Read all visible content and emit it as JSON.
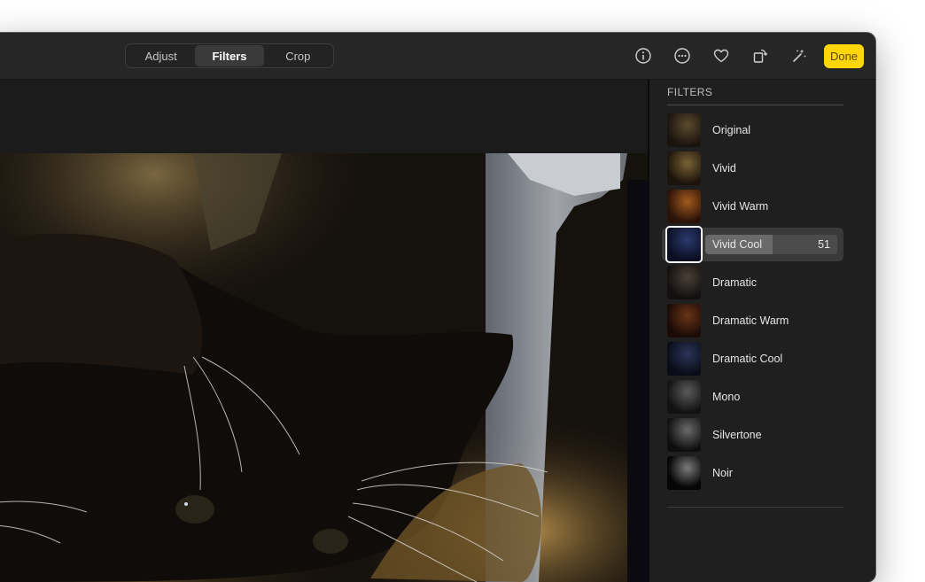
{
  "toolbar": {
    "tabs": [
      "Adjust",
      "Filters",
      "Crop"
    ],
    "active_tab": "Filters",
    "icons": [
      "info-icon",
      "more-icon",
      "heart-icon",
      "rotate-icon",
      "magic-wand-icon"
    ],
    "done_label": "Done",
    "done_color": "#ffd60a"
  },
  "sidebar": {
    "title": "FILTERS",
    "filters": [
      {
        "label": "Original"
      },
      {
        "label": "Vivid"
      },
      {
        "label": "Vivid Warm"
      },
      {
        "label": "Vivid Cool",
        "selected": true,
        "intensity": 51
      },
      {
        "label": "Dramatic"
      },
      {
        "label": "Dramatic Warm"
      },
      {
        "label": "Dramatic Cool"
      },
      {
        "label": "Mono"
      },
      {
        "label": "Silvertone"
      },
      {
        "label": "Noir"
      }
    ]
  }
}
